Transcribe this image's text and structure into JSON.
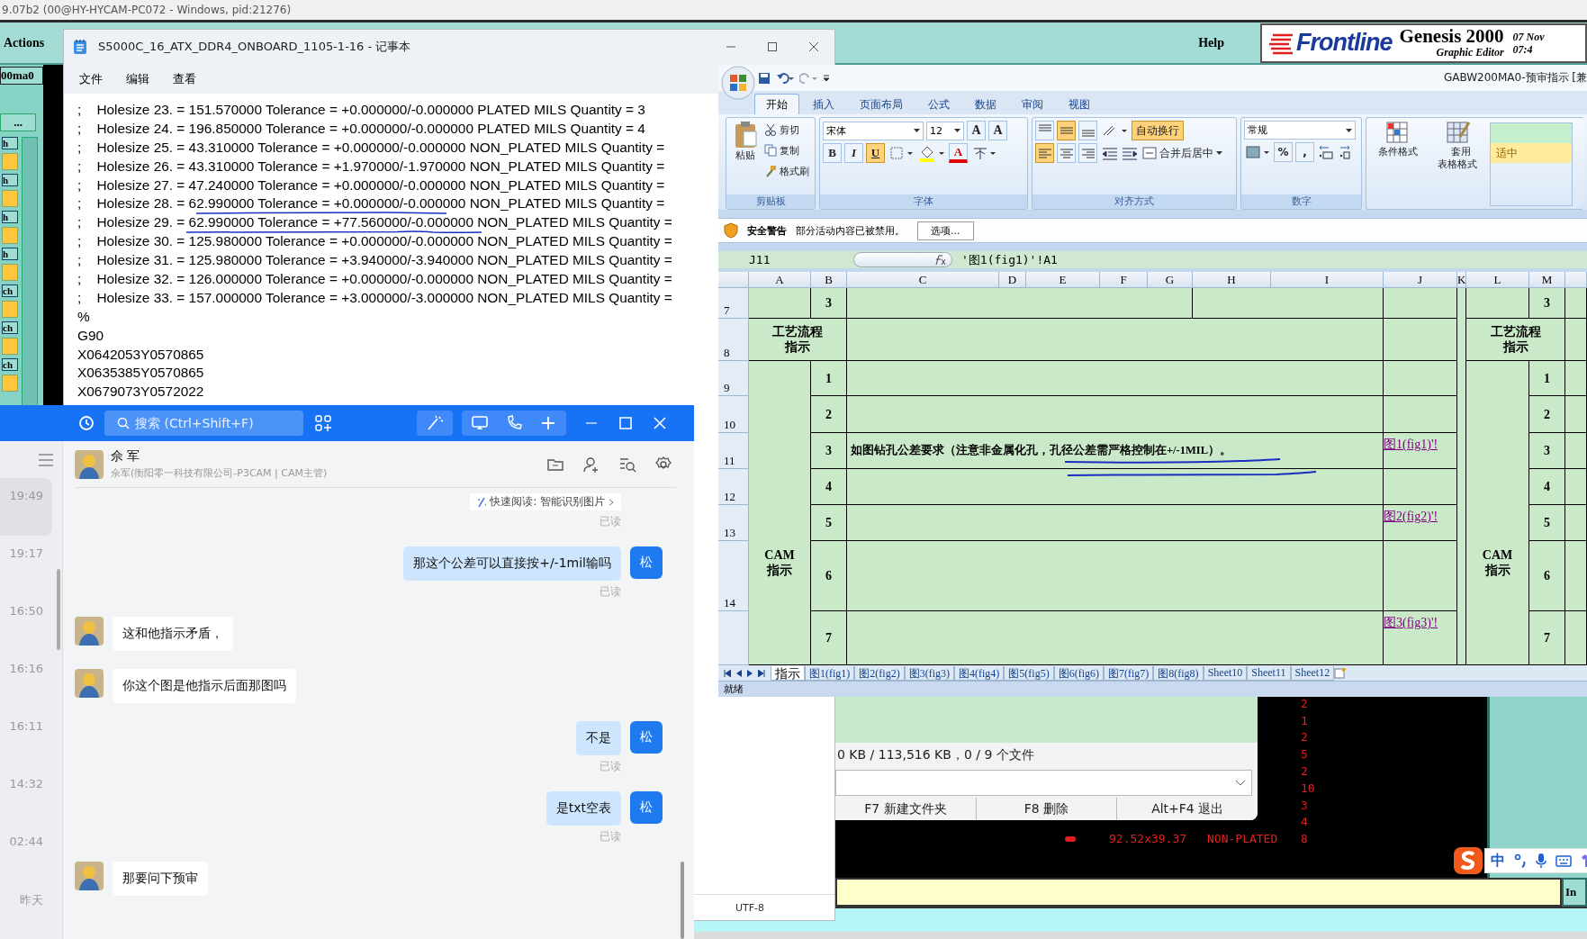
{
  "genesis": {
    "title_bar": "9.07b2 (00@HY-HYCAM-PC072 - Windows, pid:21276)",
    "menus": [
      "Actions",
      "Help"
    ],
    "logo": "Frontline",
    "product": "Genesis 2000",
    "subtitle": "Graphic Editor",
    "date": "07 Nov",
    "time": "07:4",
    "job": "00ma0",
    "more_button": "...",
    "side_buttons": [
      "h",
      "h",
      "h",
      "h",
      "ch",
      "ch",
      "ch"
    ],
    "drill_rows": [
      {
        "count": "2"
      },
      {
        "count": "1"
      },
      {
        "count": "2"
      },
      {
        "count": "5"
      },
      {
        "count": "2"
      },
      {
        "count": "10"
      },
      {
        "count": "3"
      },
      {
        "count": "4"
      },
      {
        "size": "92.52x39.37",
        "type": "NON-PLATED",
        "count": "8"
      }
    ],
    "command_button": "In"
  },
  "notepad": {
    "title": "S5000C_16_ATX_DDR4_ONBOARD_1105-1-16 - 记事本",
    "menus": [
      "文件",
      "编辑",
      "查看"
    ],
    "lines": [
      ";\tHolesize 23. = 151.570000 Tolerance = +0.000000/-0.000000 PLATED MILS Quantity = 3",
      ";\tHolesize 24. = 196.850000 Tolerance = +0.000000/-0.000000 PLATED MILS Quantity = 4",
      ";\tHolesize 25. = 43.310000 Tolerance = +0.000000/-0.000000 NON_PLATED MILS Quantity =",
      ";\tHolesize 26. = 43.310000 Tolerance = +1.970000/-1.970000 NON_PLATED MILS Quantity =",
      ";\tHolesize 27. = 47.240000 Tolerance = +0.000000/-0.000000 NON_PLATED MILS Quantity =",
      ";\tHolesize 28. = 62.990000 Tolerance = +0.000000/-0.000000 NON_PLATED MILS Quantity =",
      ";\tHolesize 29. = 62.990000 Tolerance = +77.560000/-0.000000 NON_PLATED MILS Quantity =",
      ";\tHolesize 30. = 125.980000 Tolerance = +0.000000/-0.000000 NON_PLATED MILS Quantity =",
      ";\tHolesize 31. = 125.980000 Tolerance = +3.940000/-3.940000 NON_PLATED MILS Quantity =",
      ";\tHolesize 32. = 126.000000 Tolerance = +0.000000/-0.000000 NON_PLATED MILS Quantity =",
      ";\tHolesize 33. = 157.000000 Tolerance = +3.000000/-3.000000 NON_PLATED MILS Quantity =",
      "%",
      "G90",
      "X0642053Y0570865",
      "X0635385Y0570865",
      "X0679073Y0572022"
    ],
    "encoding": "UTF-8"
  },
  "file_dialog": {
    "summary": "0 KB / 113,516 KB，0 / 9 个文件",
    "buttons": [
      "F7 新建文件夹",
      "F8 删除",
      "Alt+F4 退出"
    ]
  },
  "excel": {
    "title": "GABW200MA0-预审指示  [兼",
    "tabs": [
      {
        "label": "开始",
        "selected": true
      },
      {
        "label": "插入",
        "selected": false
      },
      {
        "label": "页面布局",
        "selected": false
      },
      {
        "label": "公式",
        "selected": false
      },
      {
        "label": "数据",
        "selected": false
      },
      {
        "label": "审阅",
        "selected": false
      },
      {
        "label": "视图",
        "selected": false
      }
    ],
    "clipboard": {
      "paste": "粘贴",
      "actions": [
        "剪切",
        "复制",
        "格式刷"
      ],
      "label": "剪贴板"
    },
    "font": {
      "name": "宋体",
      "size": "12",
      "glyphs": [
        "A",
        "A"
      ],
      "styles": [
        {
          "label": "B",
          "on": false
        },
        {
          "label": "I",
          "on": false
        },
        {
          "label": "U",
          "on": true
        }
      ],
      "color_label": "A",
      "label": "字体"
    },
    "alignment": {
      "vertical": [
        {
          "kind": "top",
          "on": false
        },
        {
          "kind": "middle",
          "on": true
        },
        {
          "kind": "bottom",
          "on": false
        }
      ],
      "horizontal": [
        {
          "kind": "left",
          "on": true
        },
        {
          "kind": "center",
          "on": false
        },
        {
          "kind": "right",
          "on": false
        }
      ],
      "wrap": {
        "label": "自动换行",
        "on": true
      },
      "merge": "合并后居中",
      "label": "对齐方式"
    },
    "number": {
      "format": "常规",
      "symbols": [
        "%",
        ","
      ],
      "label": "数字"
    },
    "styles": {
      "buttons": [
        "条件格式",
        "套用表格格式"
      ],
      "cells": [
        {
          "color": "#c6efce"
        },
        {
          "label": "适中",
          "color": "#ffeb9c"
        }
      ]
    },
    "security": {
      "title": "安全警告",
      "message": "部分活动内容已被禁用。",
      "button": "选项..."
    },
    "formula": {
      "name_box": "J11",
      "content": "'图1(fig1)'!A1"
    },
    "columns": [
      "A",
      "B",
      "C",
      "D",
      "E",
      "F",
      "G",
      "H",
      "I",
      "J",
      "K",
      "L",
      "M"
    ],
    "row_numbers": [
      "7",
      "8",
      "9",
      "10",
      "11",
      "12",
      "13",
      "14"
    ],
    "cells": [
      {
        "kind": "text",
        "text": "3"
      },
      {
        "kind": "text",
        "text": "工艺流程指示"
      },
      {
        "kind": "text",
        "text": "1"
      },
      {
        "kind": "text",
        "text": "2"
      },
      {
        "kind": "text",
        "text": "3"
      },
      {
        "kind": "text",
        "text": "如图钻孔公差要求（注意非金属化孔，孔径公差需严格控制在+/-1MIL）。"
      },
      {
        "kind": "link",
        "text": "图1(fig1)'!"
      },
      {
        "kind": "text",
        "text": "4"
      },
      {
        "kind": "text",
        "text": "5"
      },
      {
        "kind": "link",
        "text": "图2(fig2)'!"
      },
      {
        "kind": "text",
        "text": "6"
      },
      {
        "kind": "text",
        "text": "7"
      },
      {
        "kind": "link",
        "text": "图3(fig3)'!"
      },
      {
        "kind": "text",
        "text": "CAM\n指示"
      },
      {
        "kind": "text",
        "text": "3"
      },
      {
        "kind": "text",
        "text": "工艺流程指示"
      },
      {
        "kind": "text",
        "text": "1"
      },
      {
        "kind": "text",
        "text": "2"
      },
      {
        "kind": "text",
        "text": "3"
      },
      {
        "kind": "text",
        "text": "4"
      },
      {
        "kind": "text",
        "text": "5"
      },
      {
        "kind": "text",
        "text": "6"
      },
      {
        "kind": "text",
        "text": "7"
      },
      {
        "kind": "text",
        "text": "CAM\n指示"
      }
    ],
    "sheets": [
      {
        "label": "指示",
        "selected": true
      },
      {
        "label": "图1(fig1)",
        "selected": false
      },
      {
        "label": "图2(fig2)",
        "selected": false
      },
      {
        "label": "图3(fig3)",
        "selected": false
      },
      {
        "label": "图4(fig4)",
        "selected": false
      },
      {
        "label": "图5(fig5)",
        "selected": false
      },
      {
        "label": "图6(fig6)",
        "selected": false
      },
      {
        "label": "图7(fig7)",
        "selected": false
      },
      {
        "label": "图8(fig8)",
        "selected": false
      },
      {
        "label": "Sheet10",
        "selected": false
      },
      {
        "label": "Sheet11",
        "selected": false
      },
      {
        "label": "Sheet12",
        "selected": false
      }
    ],
    "status": "就绪"
  },
  "chat": {
    "search": {
      "placeholder": "搜索 (Ctrl+Shift+F)"
    },
    "sessions": [
      {
        "time": "19:49",
        "selected": true
      },
      {
        "time": "19:17",
        "selected": false
      },
      {
        "time": "16:50",
        "selected": false
      },
      {
        "time": "16:16",
        "selected": false
      },
      {
        "time": "16:11",
        "selected": false
      },
      {
        "time": "14:32",
        "selected": false
      },
      {
        "time": "02:44",
        "selected": false
      },
      {
        "time": "昨天",
        "selected": false
      }
    ],
    "contact": {
      "name": "佘 军",
      "detail": "佘军(衡阳零一科技有限公司-P3CAM | CAM主管)"
    },
    "messages": [
      {
        "kind": "notice",
        "text": "快速阅读: 智能识别图片",
        "status": "已读"
      },
      {
        "kind": "sent",
        "text": "那这个公差可以直接按+/-1mil输吗",
        "avatar": "松",
        "status": "已读"
      },
      {
        "kind": "received",
        "text": "这和他指示矛盾，"
      },
      {
        "kind": "received",
        "text": "你这个图是他指示后面那图吗"
      },
      {
        "kind": "sent",
        "text": "不是",
        "avatar": "松",
        "status": "已读"
      },
      {
        "kind": "sent",
        "text": "是txt空表",
        "avatar": "松",
        "status": "已读"
      },
      {
        "kind": "received",
        "text": "那要问下预审"
      }
    ]
  },
  "ime": {
    "mode": "中"
  }
}
